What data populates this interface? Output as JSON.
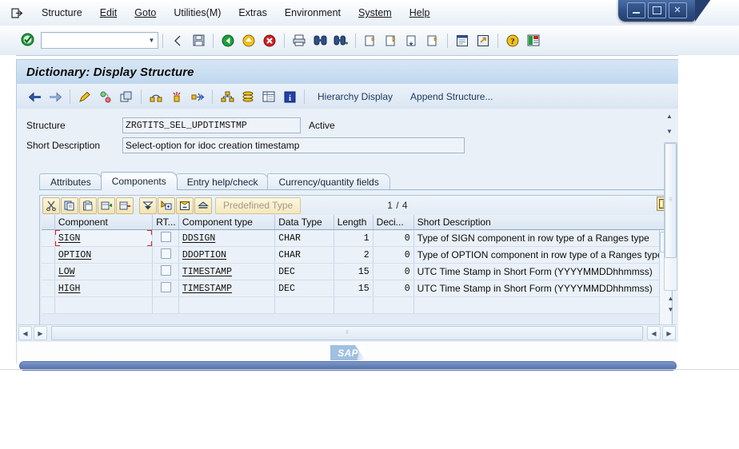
{
  "menu": {
    "system_icon": "session-icon",
    "items": [
      {
        "label": "Structure",
        "accel": ""
      },
      {
        "label": "Edit",
        "accel": "E"
      },
      {
        "label": "Goto",
        "accel": "G"
      },
      {
        "label": "Utilities(M)",
        "accel": "M"
      },
      {
        "label": "Extras",
        "accel": "a"
      },
      {
        "label": "Environment",
        "accel": "v"
      },
      {
        "label": "System",
        "accel": "y"
      },
      {
        "label": "Help",
        "accel": "H"
      }
    ]
  },
  "window_controls": {
    "minimize": "minimize-icon",
    "restore": "restore-icon",
    "close": "close-icon"
  },
  "toolbar": {
    "enter_icon": "enter-check-icon",
    "command_field_value": "",
    "command_field_placeholder": "",
    "buttons": [
      {
        "name": "back-triangle-icon",
        "title": ""
      },
      {
        "name": "save-icon",
        "title": "Save"
      },
      {
        "name": "back-green-icon",
        "title": "Back"
      },
      {
        "name": "exit-yellow-icon",
        "title": "Exit"
      },
      {
        "name": "cancel-red-icon",
        "title": "Cancel"
      },
      {
        "name": "print-icon",
        "title": "Print"
      },
      {
        "name": "find-icon",
        "title": "Find"
      },
      {
        "name": "find-next-icon",
        "title": "Find Next"
      },
      {
        "name": "first-page-icon",
        "title": "First Page"
      },
      {
        "name": "previous-page-icon",
        "title": "Previous Page"
      },
      {
        "name": "next-page-icon",
        "title": "Next Page"
      },
      {
        "name": "last-page-icon",
        "title": "Last Page"
      },
      {
        "name": "create-session-icon",
        "title": "Create Session"
      },
      {
        "name": "create-shortcut-icon",
        "title": "Create Shortcut"
      },
      {
        "name": "help-icon",
        "title": "Help"
      },
      {
        "name": "customize-layout-icon",
        "title": "Customizing of Local Layout"
      }
    ]
  },
  "screen": {
    "title": "Dictionary: Display Structure"
  },
  "app_toolbar": {
    "icons": [
      {
        "name": "back-arrow-icon"
      },
      {
        "name": "forward-arrow-icon"
      },
      {
        "name": "display-change-pencil-icon"
      },
      {
        "name": "check-consistency-icon"
      },
      {
        "name": "copy-object-icon"
      },
      {
        "name": "activate-object-icon"
      },
      {
        "name": "activation-log-icon"
      },
      {
        "name": "where-used-list-icon"
      },
      {
        "name": "hierarchy-icon"
      },
      {
        "name": "database-object-icon"
      },
      {
        "name": "table-contents-icon"
      },
      {
        "name": "info-icon"
      }
    ],
    "hierarchy_display_label": "Hierarchy Display",
    "append_structure_label": "Append Structure..."
  },
  "form": {
    "structure_label": "Structure",
    "structure_value": "ZRGTITS_SEL_UPDTIMSTMP",
    "status_value": "Active",
    "short_description_label": "Short Description",
    "short_description_value": "Select-option for idoc creation timestamp"
  },
  "tabs": [
    {
      "label": "Attributes",
      "active": false
    },
    {
      "label": "Components",
      "active": true
    },
    {
      "label": "Entry help/check",
      "active": false
    },
    {
      "label": "Currency/quantity fields",
      "active": false
    }
  ],
  "grid_toolbar": {
    "buttons": [
      {
        "name": "cut-icon"
      },
      {
        "name": "copy-icon"
      },
      {
        "name": "paste-icon"
      },
      {
        "name": "insert-row-icon"
      },
      {
        "name": "delete-row-icon"
      },
      {
        "name": "expand-include-icon"
      },
      {
        "name": "append-include-icon"
      },
      {
        "name": "collapse-include-icon"
      },
      {
        "name": "sort-ascending-icon"
      }
    ],
    "predefined_type_label": "Predefined Type",
    "row_counter": "1 / 4"
  },
  "grid": {
    "columns": [
      {
        "key": "component",
        "label": "Component"
      },
      {
        "key": "rt",
        "label": "RT..."
      },
      {
        "key": "component_type",
        "label": "Component type"
      },
      {
        "key": "data_type",
        "label": "Data Type"
      },
      {
        "key": "length",
        "label": "Length"
      },
      {
        "key": "decimals",
        "label": "Deci..."
      },
      {
        "key": "short_description",
        "label": "Short Description"
      }
    ],
    "config_icon": "table-settings-icon",
    "rows": [
      {
        "component": "SIGN",
        "rt": false,
        "component_type": "DDSIGN",
        "data_type": "CHAR",
        "length": "1",
        "decimals": "0",
        "short_description": "Type of SIGN component in row type of a Ranges type",
        "selected": true
      },
      {
        "component": "OPTION",
        "rt": false,
        "component_type": "DDOPTION",
        "data_type": "CHAR",
        "length": "2",
        "decimals": "0",
        "short_description": "Type of OPTION component in row type of a Ranges type",
        "selected": false
      },
      {
        "component": "LOW",
        "rt": false,
        "component_type": "TIMESTAMP",
        "data_type": "DEC",
        "length": "15",
        "decimals": "0",
        "short_description": "UTC Time Stamp in Short Form (YYYYMMDDhhmmss)",
        "selected": false
      },
      {
        "component": "HIGH",
        "rt": false,
        "component_type": "TIMESTAMP",
        "data_type": "DEC",
        "length": "15",
        "decimals": "0",
        "short_description": "UTC Time Stamp in Short Form (YYYYMMDDhhmmss)",
        "selected": false
      },
      {
        "component": "",
        "rt": false,
        "component_type": "",
        "data_type": "",
        "length": "",
        "decimals": "",
        "short_description": "",
        "selected": false
      }
    ]
  },
  "footer": {
    "logo_text": "SAP",
    "resize_icon": "resize-handle-icon"
  }
}
